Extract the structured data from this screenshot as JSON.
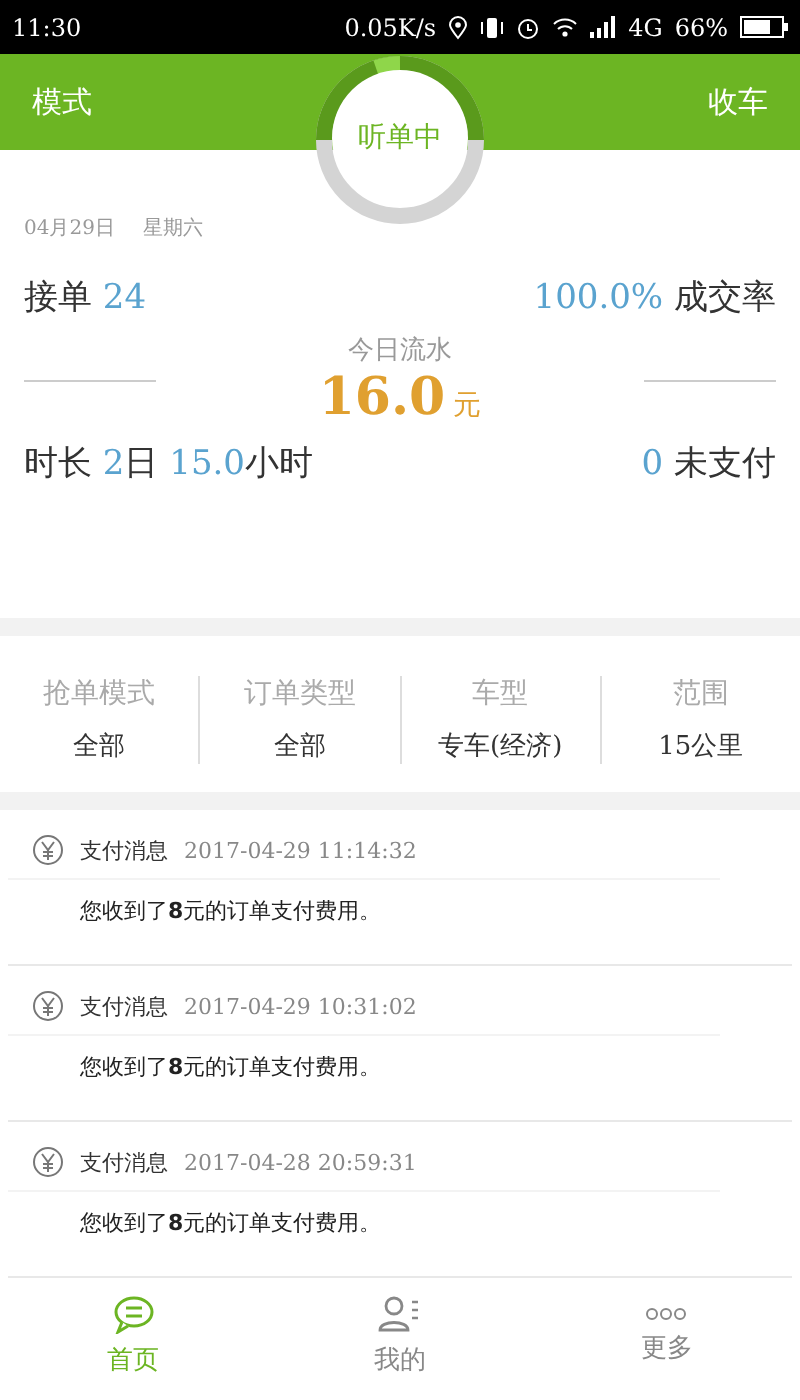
{
  "status_bar": {
    "time": "11:30",
    "speed": "0.05K/s",
    "network": "4G",
    "battery": "66%"
  },
  "header": {
    "left": "模式",
    "right": "收车",
    "status": "听单中"
  },
  "date": {
    "day": "04月29日",
    "weekday": "星期六"
  },
  "stats": {
    "orders_label": "接单",
    "orders": "24",
    "rate": "100.0%",
    "rate_label": "成交率",
    "income_label": "今日流水",
    "income": "16.0",
    "currency": "元",
    "duration_label": "时长",
    "days": "2",
    "days_unit": "日",
    "hours": "15.0",
    "hours_unit": "小时",
    "unpaid": "0",
    "unpaid_label": "未支付"
  },
  "filters": [
    {
      "label": "抢单模式",
      "value": "全部"
    },
    {
      "label": "订单类型",
      "value": "全部"
    },
    {
      "label": "车型",
      "value": "专车(经济)"
    },
    {
      "label": "范围",
      "value": "15公里"
    }
  ],
  "messages": [
    {
      "title": "支付消息",
      "time": "2017-04-29 11:14:32",
      "body": "您收到了**8**元的订单支付费用。"
    },
    {
      "title": "支付消息",
      "time": "2017-04-29 10:31:02",
      "body": "您收到了**8**元的订单支付费用。"
    },
    {
      "title": "支付消息",
      "time": "2017-04-28 20:59:31",
      "body": "您收到了**8**元的订单支付费用。"
    }
  ],
  "nav": [
    {
      "label": "首页",
      "kind": "home",
      "selected": true
    },
    {
      "label": "我的",
      "kind": "profile",
      "selected": false
    },
    {
      "label": "更多",
      "kind": "more",
      "selected": false
    }
  ]
}
